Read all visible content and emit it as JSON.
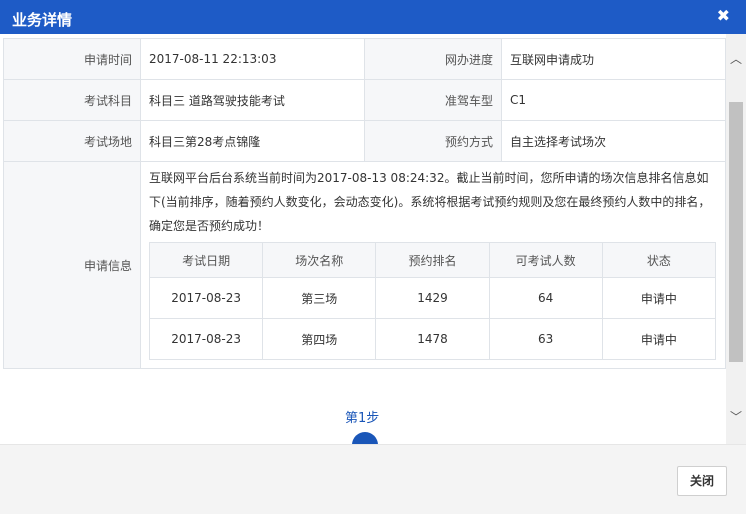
{
  "dialog": {
    "title": "业务详情",
    "close_symbol": "✖"
  },
  "info": {
    "apply_time_label": "申请时间",
    "apply_time": "2017-08-11 22:13:03",
    "progress_label": "网办进度",
    "progress": "互联网申请成功",
    "subject_label": "考试科目",
    "subject": "科目三 道路驾驶技能考试",
    "vehicle_label": "准驾车型",
    "vehicle": "C1",
    "site_label": "考试场地",
    "site": "科目三第28考点锦隆",
    "booking_label": "预约方式",
    "booking": "自主选择考试场次",
    "apply_info_label": "申请信息",
    "message": "互联网平台后台系统当前时间为2017-08-13 08:24:32。截止当前时间，您所申请的场次信息排名信息如下(当前排序，随着预约人数变化，会动态变化)。系统将根据考试预约规则及您在最终预约人数中的排名，确定您是否预约成功！"
  },
  "sessions": {
    "headers": [
      "考试日期",
      "场次名称",
      "预约排名",
      "可考试人数",
      "状态"
    ],
    "rows": [
      [
        "2017-08-23",
        "第三场",
        "1429",
        "64",
        "申请中"
      ],
      [
        "2017-08-23",
        "第四场",
        "1478",
        "63",
        "申请中"
      ]
    ]
  },
  "steps": {
    "current_label": "第1步"
  },
  "scrollbar": {
    "up_symbol": "︿",
    "down_symbol": "﹀"
  },
  "footer": {
    "close_label": "关闭"
  },
  "colors": {
    "titlebar": "#1e5bc6",
    "step": "#1a56b8"
  }
}
